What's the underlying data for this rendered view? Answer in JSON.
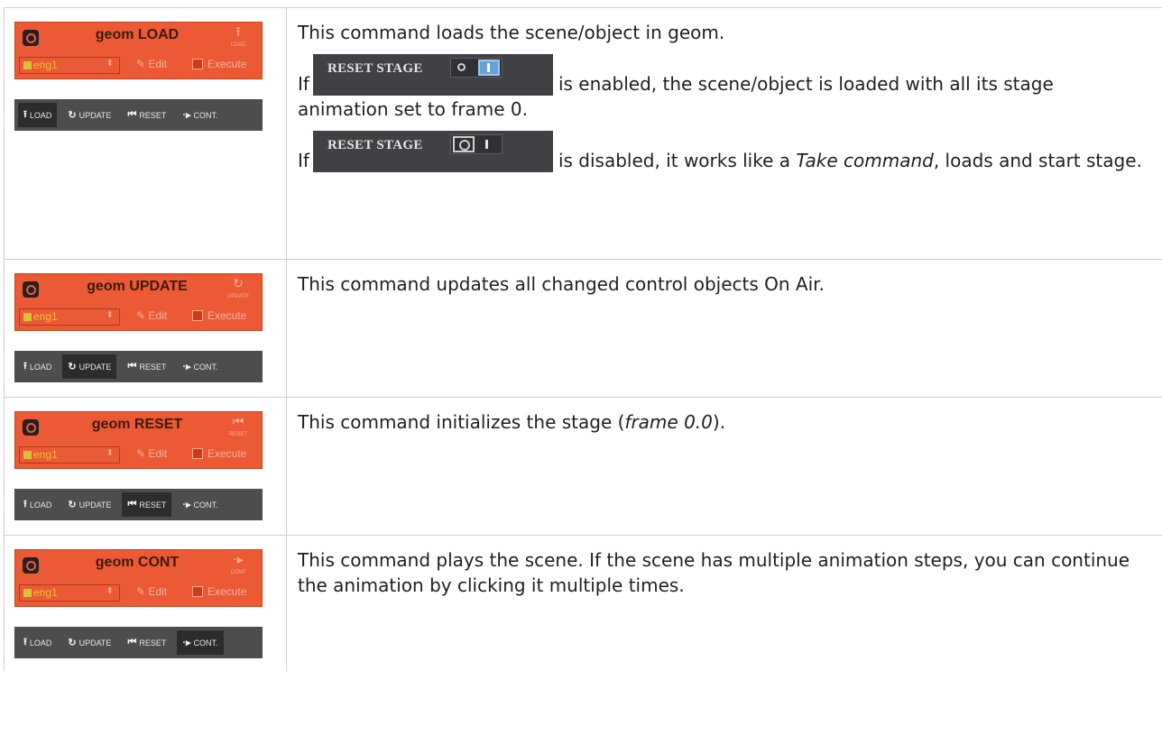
{
  "widget_common": {
    "engine": "eng1",
    "edit": "Edit",
    "execute": "Execute"
  },
  "toolbar": {
    "load": "LOAD",
    "update": "UPDATE",
    "reset": "RESET",
    "cont": "CONT."
  },
  "rows": [
    {
      "title": "geom LOAD",
      "icon_label": "LOAD",
      "active_tab": "load"
    },
    {
      "title": "geom UPDATE",
      "icon_label": "UPDATE",
      "active_tab": "update"
    },
    {
      "title": "geom RESET",
      "icon_label": "RESET",
      "active_tab": "reset"
    },
    {
      "title": "geom CONT",
      "icon_label": "CONT",
      "active_tab": "cont"
    }
  ],
  "reset_stage_label": "RESET STAGE",
  "descriptions": {
    "load_intro": "This command loads the scene/object in geom.",
    "load_if1": "If",
    "load_enabled": "is enabled, the scene/object is loaded with all its stage animation set to frame 0.",
    "load_if2": "If",
    "load_disabled_before": "is disabled, it works like a",
    "load_take_command": "Take command",
    "load_disabled_after": ", loads and start stage.",
    "update": "This command updates all changed control objects On Air.",
    "reset_before": "This command initializes the stage (",
    "reset_frame": "frame 0.0",
    "reset_after": ").",
    "cont": "This command plays the scene. If the scene has multiple animation steps, you can continue the animation by clicking it multiple times."
  },
  "icons": {
    "load": "upload-icon",
    "update": "refresh-icon",
    "reset": "rewind-icon",
    "cont": "step-play-icon",
    "logo": "geom-logo-icon",
    "engine": "monitor-icon",
    "edit": "pencil-icon",
    "execute": "execute-icon"
  },
  "colors": {
    "widget_bg": "#ec5a35",
    "toolbar_bg": "#4b4d4f",
    "toolbar_active": "#2b2c2e",
    "toggle_on": "#6aa0d8"
  }
}
